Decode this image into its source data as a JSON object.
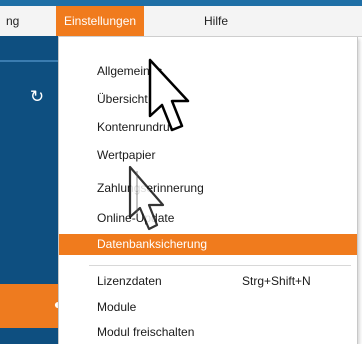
{
  "menubar": {
    "left_fragment": "ng",
    "settings_label": "Einstellungen",
    "help_label": "Hilfe"
  },
  "menu": {
    "items": [
      {
        "label": "Allgemeines"
      },
      {
        "label": "Übersicht"
      },
      {
        "label": "Kontenrundruf"
      },
      {
        "label": "Wertpapier"
      },
      {
        "label": "Zahlungserinnerung"
      },
      {
        "label": "Online-Update"
      },
      {
        "label": "Datenbanksicherung"
      },
      {
        "label": "Lizenzdaten",
        "shortcut": "Strg+Shift+N"
      },
      {
        "label": "Module"
      },
      {
        "label": "Modul freischalten"
      }
    ]
  },
  "colors": {
    "accent": "#f07b1d",
    "panel_blue": "#0e4f80",
    "top_blue": "#1f6fa6"
  },
  "icons": {
    "refresh": "refresh-icon",
    "cursor": "mouse-pointer-icon"
  }
}
